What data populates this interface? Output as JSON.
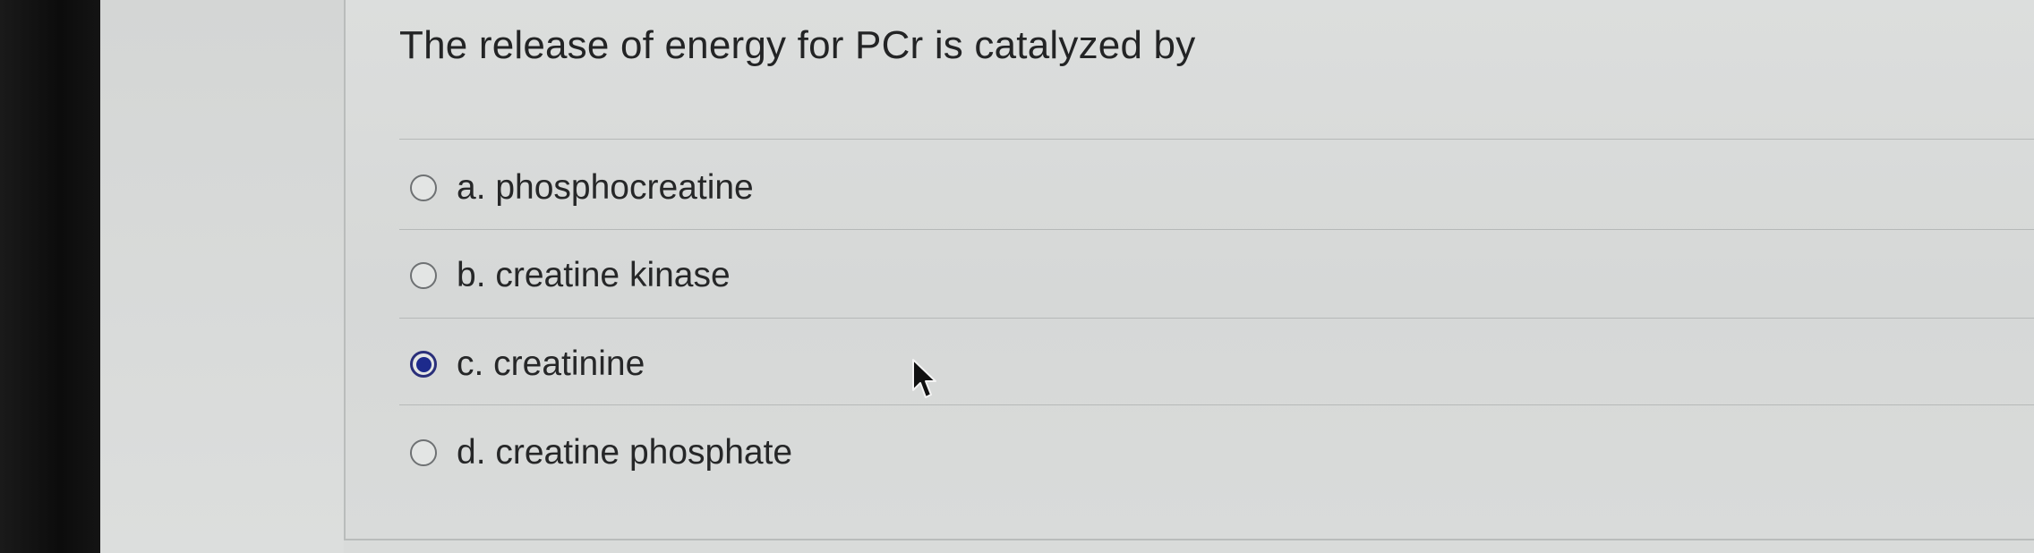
{
  "question": {
    "text": "The release of energy for PCr is catalyzed by"
  },
  "options": [
    {
      "label": "a. phosphocreatine",
      "selected": false
    },
    {
      "label": "b. creatine kinase",
      "selected": false
    },
    {
      "label": "c. creatinine",
      "selected": true
    },
    {
      "label": "d. creatine phosphate",
      "selected": false
    }
  ],
  "colors": {
    "selected_radio": "#1d2a8c",
    "text": "#232425"
  },
  "icons": {
    "cursor": "arrow-cursor-icon"
  }
}
